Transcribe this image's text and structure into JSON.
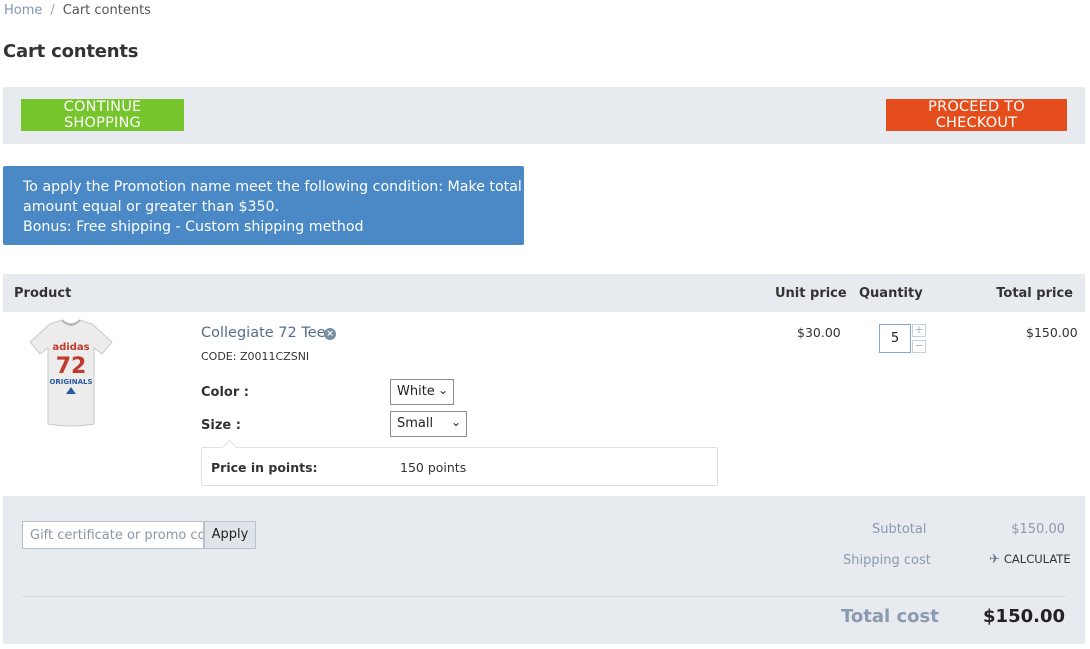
{
  "breadcrumb": {
    "home": "Home",
    "separator": "/",
    "current": "Cart contents"
  },
  "page_title": "Cart contents",
  "actions": {
    "continue": "CONTINUE SHOPPING",
    "checkout": "PROCEED TO CHECKOUT"
  },
  "promo_notice": {
    "line1": "To apply the Promotion name meet the following condition: Make total",
    "line2": "amount equal or greater than $350.",
    "line3": "Bonus: Free shipping - Custom shipping method"
  },
  "table": {
    "headers": {
      "product": "Product",
      "unit_price": "Unit price",
      "quantity": "Quantity",
      "total_price": "Total price"
    },
    "items": [
      {
        "name": "Collegiate 72 Tee",
        "code": "CODE: Z0011CZSNI",
        "options": [
          {
            "label": "Color :",
            "value": "White"
          },
          {
            "label": "Size :",
            "value": "Small"
          }
        ],
        "points_label": "Price in points:",
        "points_value": "150 points",
        "unit_price": "$30.00",
        "quantity": "5",
        "total_price": "$150.00"
      }
    ]
  },
  "summary": {
    "promo_placeholder": "Gift certificate or promo code",
    "apply": "Apply",
    "subtotal_label": "Subtotal",
    "subtotal_value": "$150.00",
    "shipping_label": "Shipping cost",
    "calculate": "CALCULATE",
    "total_label": "Total cost",
    "total_value": "$150.00"
  },
  "colors": {
    "green": "#77c52c",
    "orange": "#e64d1c",
    "blue": "#4a89c5",
    "panel": "#e7eaee"
  },
  "icons": {
    "remove": "remove-icon",
    "calculate": "airplane-icon",
    "dropdown": "chevron-down-icon"
  }
}
